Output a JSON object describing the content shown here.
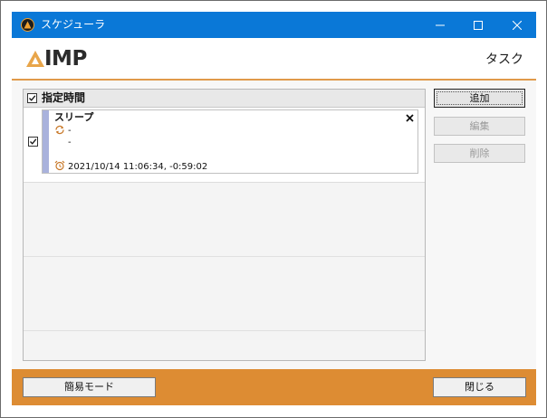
{
  "window": {
    "title": "スケジューラ",
    "min_glyph": "—",
    "max_glyph": "☐",
    "close_glyph": "✕"
  },
  "header": {
    "logo_text": "IMP",
    "title": "タスク"
  },
  "list": {
    "group_label": "指定時間",
    "group_checked": true,
    "task": {
      "checked": true,
      "title": "スリープ",
      "line1": "-",
      "line2": "-",
      "time": "2021/10/14 11:06:34, -0:59:02",
      "close_glyph": "✕"
    }
  },
  "buttons": {
    "add": "追加",
    "edit": "編集",
    "delete": "削除",
    "simple_mode": "簡易モード",
    "close": "閉じる"
  },
  "colors": {
    "titlebar": "#0a78d7",
    "accent": "#dd8c33",
    "task_accent": "#a9b2dc"
  }
}
